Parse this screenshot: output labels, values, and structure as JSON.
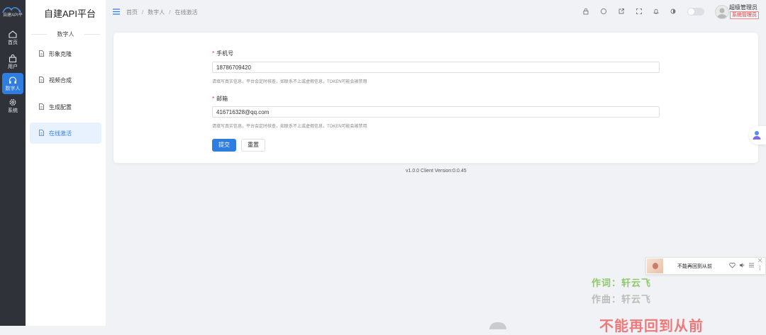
{
  "rail": {
    "logo_text": "自建API平",
    "items": [
      {
        "label": "首页",
        "icon": "home-icon"
      },
      {
        "label": "用户",
        "icon": "user-bag-icon"
      },
      {
        "label": "数字人",
        "icon": "headset-icon"
      },
      {
        "label": "系统",
        "icon": "gear-icon"
      }
    ],
    "active_index": 2
  },
  "app": {
    "title": "自建API平台"
  },
  "sidebar": {
    "header": "数字人",
    "items": [
      {
        "label": "形象克隆"
      },
      {
        "label": "视频合成"
      },
      {
        "label": "生成配置"
      },
      {
        "label": "在线激活"
      }
    ],
    "active_index": 3
  },
  "breadcrumb": {
    "items": [
      "首页",
      "数字人",
      "在线激活"
    ],
    "separator": "/"
  },
  "header": {
    "icons": [
      "lock-icon",
      "github-icon",
      "external-link-icon",
      "fullscreen-icon",
      "notification-icon",
      "theme-icon"
    ],
    "user_name": "超级管理员",
    "user_role": "系统管理员"
  },
  "form": {
    "phone_label": "手机号",
    "phone_value": "18786709420",
    "phone_hint": "请填写真实信息，平台会定时核查，如联系不上或虚假信息，TOKEN可能会被禁用",
    "email_label": "邮箱",
    "email_value": "416716328@qq.com",
    "email_hint": "请填写真实信息，平台会定时核查，如联系不上或虚假信息，TOKEN可能会被禁用",
    "required_mark": "*",
    "submit_label": "提交",
    "reset_label": "重置"
  },
  "footer": {
    "version": "v1.0.0   Client Version:0.0.45"
  },
  "player": {
    "song": "不能再回到从前",
    "icons": [
      "heart-icon",
      "volume-icon",
      "playlist-icon",
      "menu-icon",
      "close-icon"
    ]
  },
  "lyrics": {
    "line1": "作词：轩云飞",
    "line2": "作曲：轩云飞",
    "line3": "不能再回到从前"
  },
  "colors": {
    "accent": "#2f7de1",
    "rail_bg": "#2f3238",
    "required": "#e23b3b",
    "page_bg": "#f0f2f5"
  }
}
